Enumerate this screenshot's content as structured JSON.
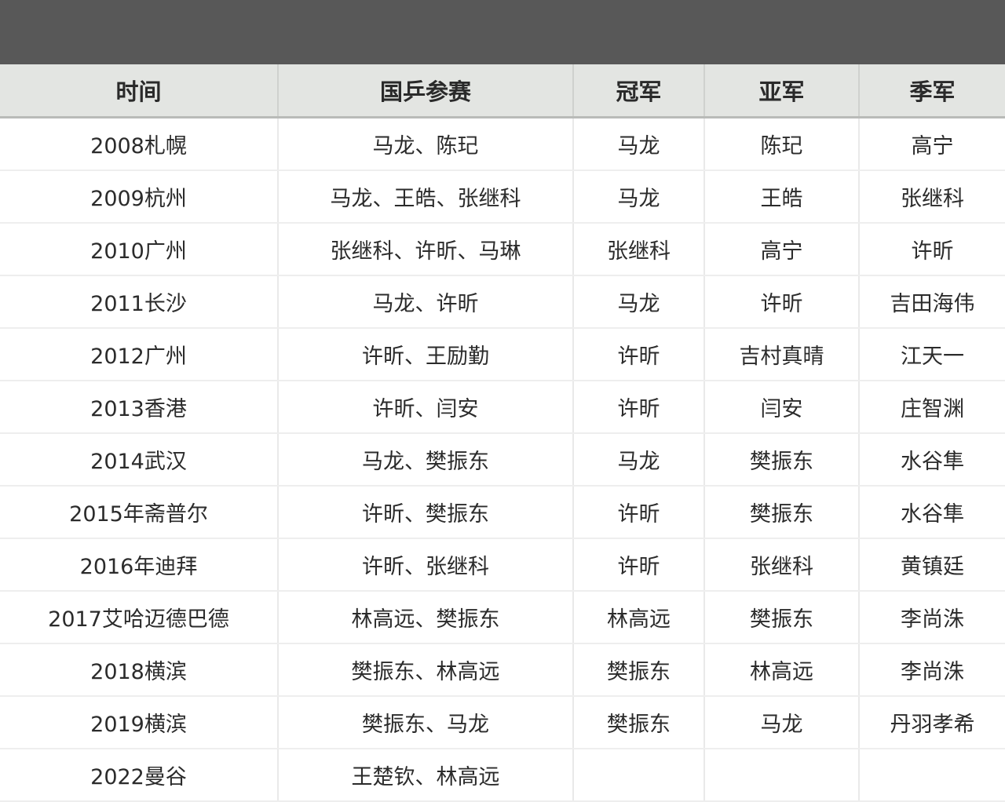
{
  "table": {
    "headers": [
      "时间",
      "国乒参赛",
      "冠军",
      "亚军",
      "季军"
    ],
    "rows": [
      [
        "2008札幌",
        "马龙、陈玘",
        "马龙",
        "陈玘",
        "高宁"
      ],
      [
        "2009杭州",
        "马龙、王皓、张继科",
        "马龙",
        "王皓",
        "张继科"
      ],
      [
        "2010广州",
        "张继科、许昕、马琳",
        "张继科",
        "高宁",
        "许昕"
      ],
      [
        "2011长沙",
        "马龙、许昕",
        "马龙",
        "许昕",
        "吉田海伟"
      ],
      [
        "2012广州",
        "许昕、王励勤",
        "许昕",
        "吉村真晴",
        "江天一"
      ],
      [
        "2013香港",
        "许昕、闫安",
        "许昕",
        "闫安",
        "庄智渊"
      ],
      [
        "2014武汉",
        "马龙、樊振东",
        "马龙",
        "樊振东",
        "水谷隼"
      ],
      [
        "2015年斋普尔",
        "许昕、樊振东",
        "许昕",
        "樊振东",
        "水谷隼"
      ],
      [
        "2016年迪拜",
        "许昕、张继科",
        "许昕",
        "张继科",
        "黄镇廷"
      ],
      [
        "2017艾哈迈德巴德",
        "林高远、樊振东",
        "林高远",
        "樊振东",
        "李尚洙"
      ],
      [
        "2018横滨",
        "樊振东、林高远",
        "樊振东",
        "林高远",
        "李尚洙"
      ],
      [
        "2019横滨",
        "樊振东、马龙",
        "樊振东",
        "马龙",
        "丹羽孝希"
      ],
      [
        "2022曼谷",
        "王楚钦、林高远",
        "",
        "",
        ""
      ]
    ]
  }
}
